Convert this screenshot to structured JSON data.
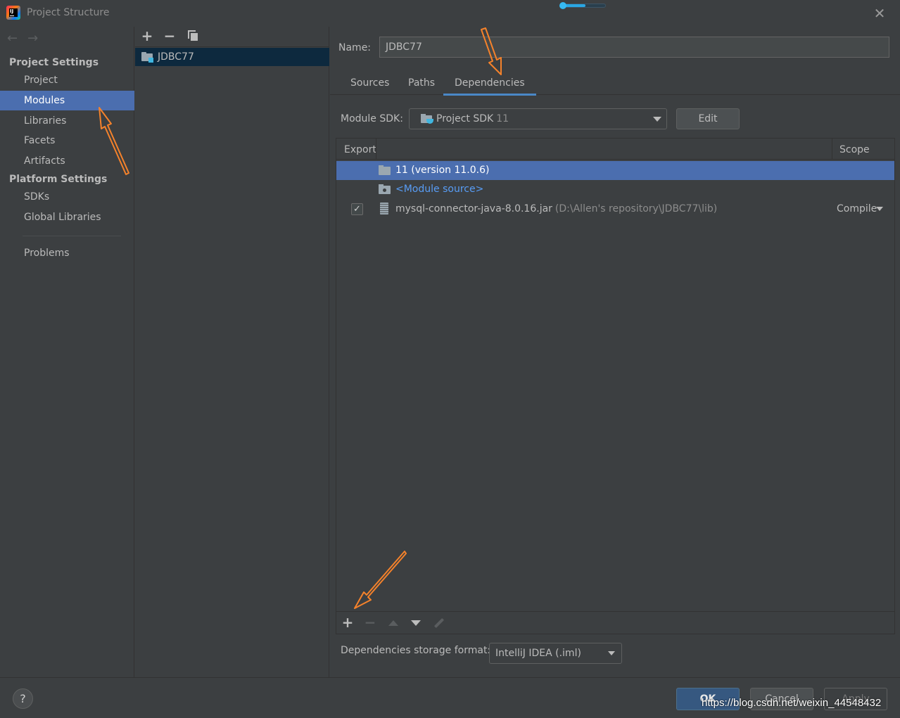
{
  "window": {
    "title": "Project Structure",
    "logo_text": "IJ",
    "progress_fraction": 0.55
  },
  "nav": {
    "project_settings_header": "Project Settings",
    "platform_settings_header": "Platform Settings",
    "items": {
      "project": "Project",
      "modules": "Modules",
      "libraries": "Libraries",
      "facets": "Facets",
      "artifacts": "Artifacts",
      "sdks": "SDKs",
      "global_libraries": "Global Libraries",
      "problems": "Problems"
    },
    "selected": "Modules"
  },
  "module_list": {
    "modules": [
      "JDBC77"
    ]
  },
  "module": {
    "name_label": "Name:",
    "name_value": "JDBC77",
    "tabs": [
      "Sources",
      "Paths",
      "Dependencies"
    ],
    "active_tab": "Dependencies",
    "sdk_label": "Module SDK:",
    "sdk_value": "Project SDK",
    "sdk_version": "11",
    "edit_label": "Edit",
    "table": {
      "col_export": "Export",
      "col_scope": "Scope",
      "rows": [
        {
          "name": "11 (version 11.0.6)",
          "path": "",
          "scope": "",
          "exported": null,
          "selected": true
        },
        {
          "name": "<Module source>",
          "path": "",
          "scope": "",
          "exported": null,
          "selected": false
        },
        {
          "name": "mysql-connector-java-8.0.16.jar",
          "path": "(D:\\Allen's repository\\JDBC77\\lib)",
          "scope": "Compile",
          "exported": true,
          "selected": false
        }
      ]
    },
    "storage_label": "Dependencies storage format:",
    "storage_value": "IntelliJ IDEA (.iml)"
  },
  "footer": {
    "help": "?",
    "ok": "OK",
    "cancel": "Cancel",
    "apply": "Apply"
  },
  "watermark": "https://blog.csdn.net/weixin_44548432",
  "colors": {
    "background": "#3c3f41",
    "selection": "#4b6eaf",
    "accent_tab": "#4a88c7",
    "annotation_arrow": "#f5822b",
    "link": "#589df6"
  }
}
